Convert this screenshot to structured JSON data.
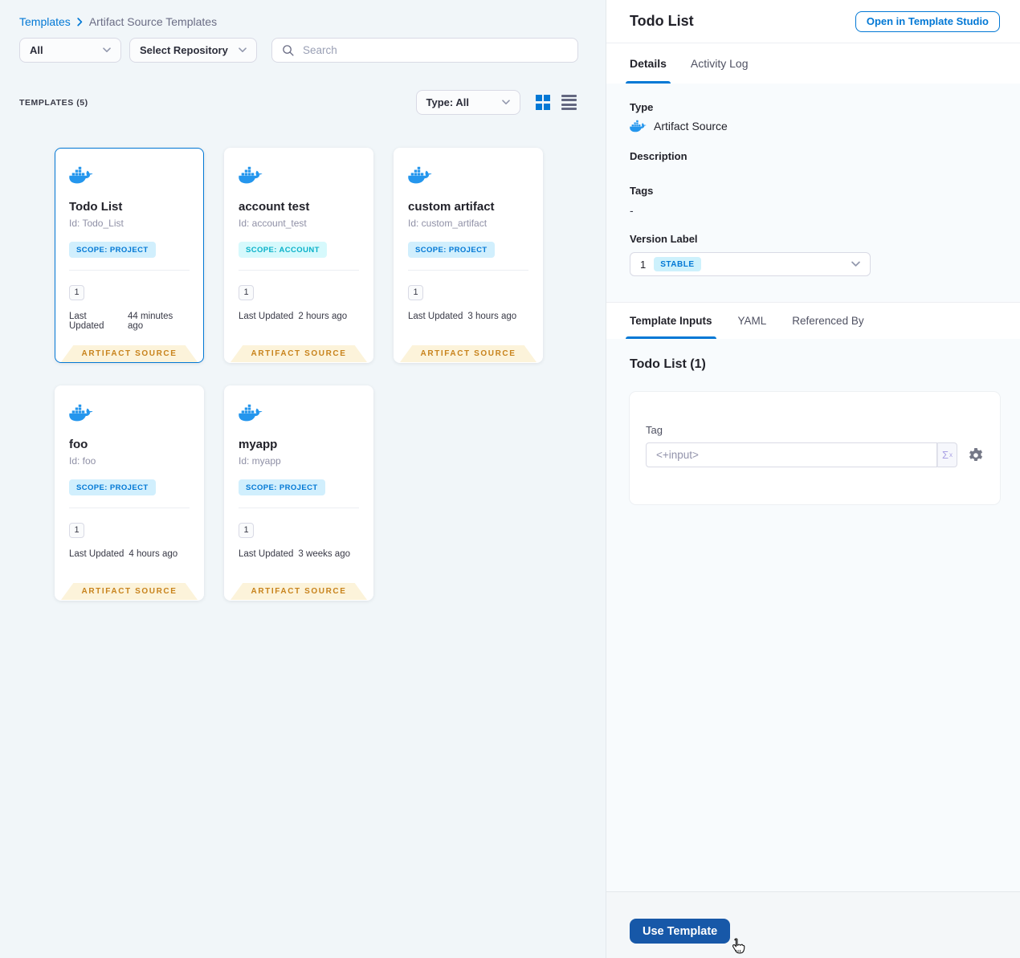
{
  "colors": {
    "primary_blue": "#0278d5",
    "docker_blue": "#2496ed",
    "scope_project_bg": "#d1effd",
    "scope_project_text": "#0278d5",
    "scope_account_bg": "#d6f9fc",
    "scope_account_text": "#0ab1c9",
    "stable_badge_bg": "#cdf1fc",
    "stable_badge_text": "#0278d5",
    "ribbon_bg": "#fcf3da",
    "ribbon_text": "#c8831c",
    "use_button_bg": "#1758a8",
    "left_background": "#f1f6f9",
    "right_background": "#f8fbfd"
  },
  "breadcrumb": {
    "root": "Templates",
    "current": "Artifact Source Templates"
  },
  "filters": {
    "scope": "All",
    "repository": "Select Repository",
    "search_placeholder": "Search"
  },
  "templates_header": {
    "count": "TEMPLATES (5)",
    "type_filter": "Type: All"
  },
  "labels": {
    "last_updated": "Last Updated",
    "ribbon": "ARTIFACT SOURCE"
  },
  "cards": [
    {
      "name": "Todo List",
      "id": "Id: Todo_List",
      "scope": "SCOPE: PROJECT",
      "version": "1",
      "updated": "44 minutes ago"
    },
    {
      "name": "account test",
      "id": "Id: account_test",
      "scope": "SCOPE: ACCOUNT",
      "version": "1",
      "updated": "2 hours ago"
    },
    {
      "name": "custom artifact",
      "id": "Id: custom_artifact",
      "scope": "SCOPE: PROJECT",
      "version": "1",
      "updated": "3 hours ago"
    },
    {
      "name": "foo",
      "id": "Id: foo",
      "scope": "SCOPE: PROJECT",
      "version": "1",
      "updated": "4 hours ago"
    },
    {
      "name": "myapp",
      "id": "Id: myapp",
      "scope": "SCOPE: PROJECT",
      "version": "1",
      "updated": "3 weeks ago"
    }
  ],
  "panel": {
    "title": "Todo List",
    "open_studio": "Open in Template Studio",
    "tabs": {
      "details": "Details",
      "activity_log": "Activity Log"
    },
    "fields": {
      "type_label": "Type",
      "type_value": "Artifact Source",
      "description_label": "Description",
      "tags_label": "Tags",
      "tags_value": "-",
      "version_label": "Version Label",
      "version_value": "1",
      "version_badge": "STABLE"
    },
    "inputs_tabs": {
      "template_inputs": "Template Inputs",
      "yaml": "YAML",
      "referenced_by": "Referenced By"
    },
    "inputs": {
      "heading": "Todo List (1)",
      "tag_label": "Tag",
      "tag_value": "<+input>",
      "expression_symbol": "Σ",
      "expression_sup": "x"
    },
    "footer": {
      "use_template": "Use Template"
    }
  }
}
